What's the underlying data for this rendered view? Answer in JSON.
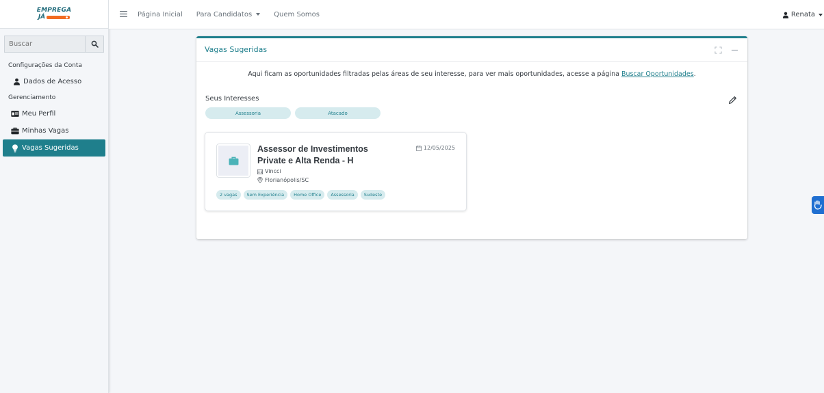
{
  "brand": {
    "logo_top": "EMPREGA",
    "logo_bottom": "JÁ"
  },
  "sidebar": {
    "search_placeholder": "Buscar",
    "sections": {
      "account": "Configurações da Conta",
      "management": "Gerenciamento"
    },
    "items": [
      {
        "label": "Dados de Acesso",
        "icon": "user-icon"
      },
      {
        "label": "Meu Perfil",
        "icon": "id-card-icon"
      },
      {
        "label": "Minhas Vagas",
        "icon": "briefcase-icon"
      },
      {
        "label": "Vagas Sugeridas",
        "icon": "lightbulb-icon",
        "active": true
      }
    ]
  },
  "topbar": {
    "nav": [
      "Página Inicial",
      "Para Candidatos",
      "Quem Somos"
    ],
    "user": "Renata"
  },
  "card": {
    "title": "Vagas Sugeridas",
    "intro_text": "Aqui ficam as oportunidades filtradas pelas áreas de seu interesse, para ver mais oportunidades, acesse a página ",
    "intro_link": "Buscar Oportunidades",
    "intro_end": ".",
    "interests_label": "Seus Interesses",
    "interests": [
      "Assessoria",
      "Atacado"
    ]
  },
  "job": {
    "title": "Assessor de Investimentos Private e Alta Renda - H",
    "date": "12/05/2025",
    "company": "Vincci",
    "location": "Florianópolis/SC",
    "tags": [
      "2 vagas",
      "Sem Experiência",
      "Home Office",
      "Assessoria",
      "Sudeste"
    ]
  },
  "colors": {
    "accent": "#1f7f8c",
    "brand_orange": "#f26b21",
    "tag_bg": "#d6ebee"
  }
}
